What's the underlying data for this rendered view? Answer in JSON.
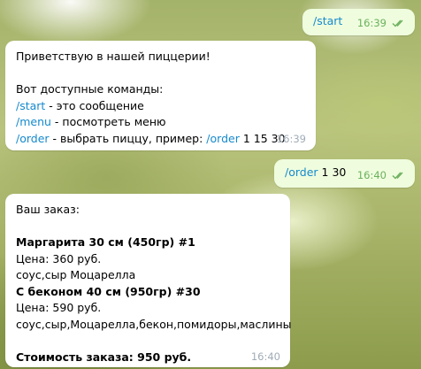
{
  "messages": [
    {
      "direction": "outgoing",
      "text": "/start",
      "time": "16:39",
      "status_icon": "double-check-icon"
    },
    {
      "direction": "incoming",
      "greeting": "Приветствую в нашей пиццерии!",
      "intro": "Вот доступные команды:",
      "commands": [
        {
          "cmd": "/start",
          "desc": " - это сообщение"
        },
        {
          "cmd": "/menu",
          "desc": " - посмотреть меню"
        },
        {
          "cmd": "/order",
          "desc": " - выбрать пиццу, пример: ",
          "example_cmd": "/order",
          "example_args": " 1 15 30"
        }
      ],
      "time": "16:39"
    },
    {
      "direction": "outgoing",
      "cmd": "/order",
      "args": " 1 30",
      "time": "16:40",
      "status_icon": "double-check-icon"
    },
    {
      "direction": "incoming",
      "title": "Ваш заказ:",
      "items": [
        {
          "name": "Маргарита 30 см (450гр) #1",
          "price": "Цена: 360 руб.",
          "ingredients": "соус,сыр Моцарелла"
        },
        {
          "name": "С беконом 40 см (950гр) #30",
          "price": "Цена: 590 руб.",
          "ingredients": "соус,сыр,Моцарелла,бекон,помидоры,маслины"
        }
      ],
      "total": "Стоимость заказа: 950 руб.",
      "time": "16:40"
    }
  ],
  "colors": {
    "outgoing_bubble": "#effdde",
    "incoming_bubble": "#ffffff",
    "link": "#168acd",
    "outgoing_meta": "#6cb05d",
    "incoming_meta": "#a0acb6"
  }
}
